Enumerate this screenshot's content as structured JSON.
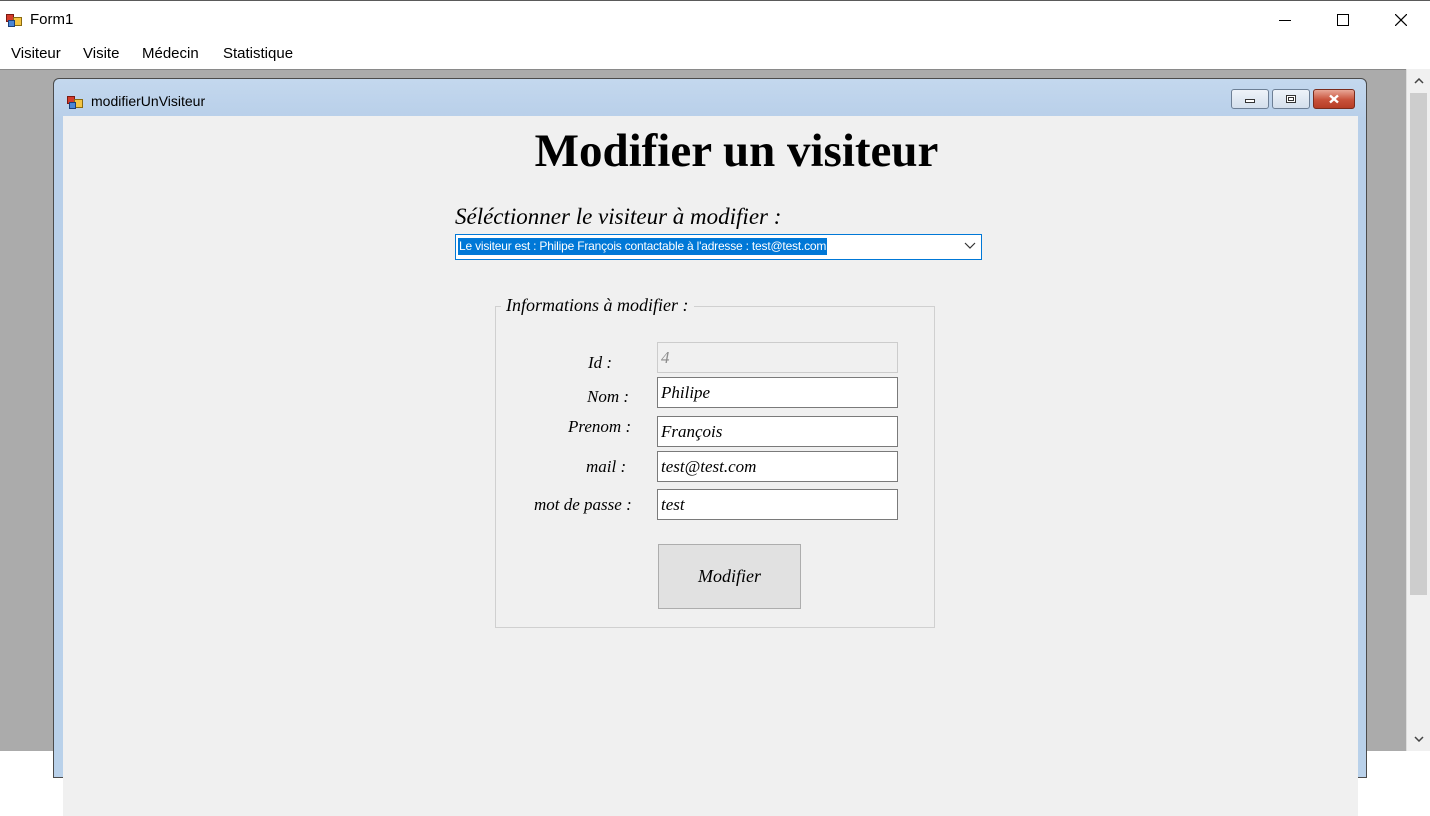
{
  "window": {
    "title": "Form1",
    "icon": "app-window-icon"
  },
  "menu": [
    {
      "label": "Visiteur"
    },
    {
      "label": "Visite"
    },
    {
      "label": "Médecin"
    },
    {
      "label": "Statistique"
    }
  ],
  "child_window": {
    "title": "modifierUnVisiteur",
    "icon": "app-window-icon"
  },
  "form": {
    "heading": "Modifier un visiteur",
    "select_label": "Séléctionner le visiteur à modifier :",
    "combo_value": "Le visiteur est : Philipe François contactable à l'adresse : test@test.com",
    "group_title": "Informations à modifier :",
    "fields": {
      "id": {
        "label": "Id :",
        "value": "4"
      },
      "nom": {
        "label": "Nom :",
        "value": "Philipe"
      },
      "prenom": {
        "label": "Prenom :",
        "value": "François"
      },
      "mail": {
        "label": "mail :",
        "value": "test@test.com"
      },
      "password": {
        "label": "mot de passe :",
        "value": "test"
      }
    },
    "submit_label": "Modifier"
  },
  "colors": {
    "selection": "#0078d7",
    "mdi_background": "#ababab",
    "form_background": "#f0f0f0",
    "child_title_gradient": "#c4d8ee"
  }
}
